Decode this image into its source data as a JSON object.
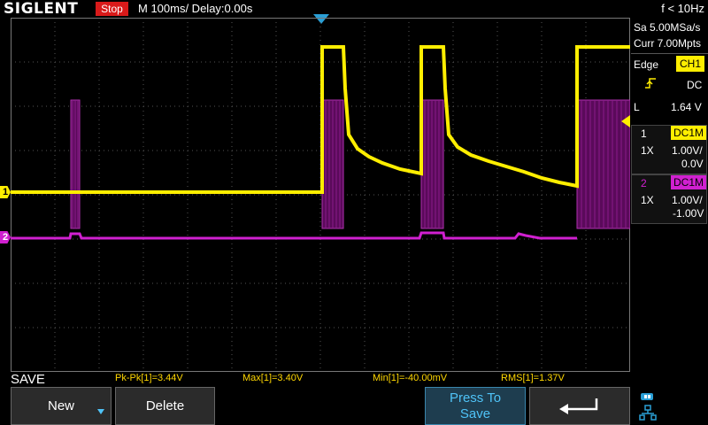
{
  "topbar": {
    "logo": "SIGLENT",
    "run_state": "Stop",
    "timebase": "M 100ms/  Delay:0.00s",
    "freq": "f < 10Hz"
  },
  "right_panel": {
    "sample_rate": "Sa 5.00MSa/s",
    "memory": "Curr 7.00Mpts",
    "trigger": {
      "type": "Edge",
      "source": "CH1",
      "coupling": "DC",
      "level_prefix": "L",
      "level": "1.64 V"
    },
    "ch1": {
      "num": "1",
      "coupling": "DC1M",
      "probe": "1X",
      "scale": "1.00V/",
      "offset": "0.0V"
    },
    "ch2": {
      "num": "2",
      "coupling": "DC1M",
      "probe": "1X",
      "scale": "1.00V/",
      "offset": "-1.00V"
    }
  },
  "markers": {
    "ch1": "1",
    "ch2": "2"
  },
  "menu_title": "SAVE",
  "measurements": [
    "Pk-Pk[1]=3.44V",
    "Max[1]=3.40V",
    "Min[1]=-40.00mV",
    "RMS[1]=1.37V"
  ],
  "softkeys": {
    "new": "New",
    "delete": "Delete",
    "press_to_save": "Press To Save"
  },
  "colors": {
    "ch1": "#ffee00",
    "ch2": "#d020d0",
    "ch2_burst": "#5a0a5a",
    "grid": "#555555",
    "trigger_marker": "#2a9fd6"
  }
}
